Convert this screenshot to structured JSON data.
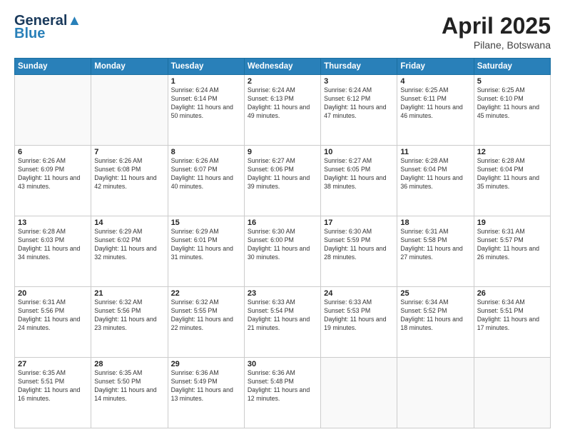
{
  "header": {
    "logo_line1": "General",
    "logo_line2": "Blue",
    "month_year": "April 2025",
    "location": "Pilane, Botswana"
  },
  "weekdays": [
    "Sunday",
    "Monday",
    "Tuesday",
    "Wednesday",
    "Thursday",
    "Friday",
    "Saturday"
  ],
  "weeks": [
    [
      {
        "day": null
      },
      {
        "day": null
      },
      {
        "day": "1",
        "sunrise": "6:24 AM",
        "sunset": "6:14 PM",
        "daylight": "11 hours and 50 minutes."
      },
      {
        "day": "2",
        "sunrise": "6:24 AM",
        "sunset": "6:13 PM",
        "daylight": "11 hours and 49 minutes."
      },
      {
        "day": "3",
        "sunrise": "6:24 AM",
        "sunset": "6:12 PM",
        "daylight": "11 hours and 47 minutes."
      },
      {
        "day": "4",
        "sunrise": "6:25 AM",
        "sunset": "6:11 PM",
        "daylight": "11 hours and 46 minutes."
      },
      {
        "day": "5",
        "sunrise": "6:25 AM",
        "sunset": "6:10 PM",
        "daylight": "11 hours and 45 minutes."
      }
    ],
    [
      {
        "day": "6",
        "sunrise": "6:26 AM",
        "sunset": "6:09 PM",
        "daylight": "11 hours and 43 minutes."
      },
      {
        "day": "7",
        "sunrise": "6:26 AM",
        "sunset": "6:08 PM",
        "daylight": "11 hours and 42 minutes."
      },
      {
        "day": "8",
        "sunrise": "6:26 AM",
        "sunset": "6:07 PM",
        "daylight": "11 hours and 40 minutes."
      },
      {
        "day": "9",
        "sunrise": "6:27 AM",
        "sunset": "6:06 PM",
        "daylight": "11 hours and 39 minutes."
      },
      {
        "day": "10",
        "sunrise": "6:27 AM",
        "sunset": "6:05 PM",
        "daylight": "11 hours and 38 minutes."
      },
      {
        "day": "11",
        "sunrise": "6:28 AM",
        "sunset": "6:04 PM",
        "daylight": "11 hours and 36 minutes."
      },
      {
        "day": "12",
        "sunrise": "6:28 AM",
        "sunset": "6:04 PM",
        "daylight": "11 hours and 35 minutes."
      }
    ],
    [
      {
        "day": "13",
        "sunrise": "6:28 AM",
        "sunset": "6:03 PM",
        "daylight": "11 hours and 34 minutes."
      },
      {
        "day": "14",
        "sunrise": "6:29 AM",
        "sunset": "6:02 PM",
        "daylight": "11 hours and 32 minutes."
      },
      {
        "day": "15",
        "sunrise": "6:29 AM",
        "sunset": "6:01 PM",
        "daylight": "11 hours and 31 minutes."
      },
      {
        "day": "16",
        "sunrise": "6:30 AM",
        "sunset": "6:00 PM",
        "daylight": "11 hours and 30 minutes."
      },
      {
        "day": "17",
        "sunrise": "6:30 AM",
        "sunset": "5:59 PM",
        "daylight": "11 hours and 28 minutes."
      },
      {
        "day": "18",
        "sunrise": "6:31 AM",
        "sunset": "5:58 PM",
        "daylight": "11 hours and 27 minutes."
      },
      {
        "day": "19",
        "sunrise": "6:31 AM",
        "sunset": "5:57 PM",
        "daylight": "11 hours and 26 minutes."
      }
    ],
    [
      {
        "day": "20",
        "sunrise": "6:31 AM",
        "sunset": "5:56 PM",
        "daylight": "11 hours and 24 minutes."
      },
      {
        "day": "21",
        "sunrise": "6:32 AM",
        "sunset": "5:56 PM",
        "daylight": "11 hours and 23 minutes."
      },
      {
        "day": "22",
        "sunrise": "6:32 AM",
        "sunset": "5:55 PM",
        "daylight": "11 hours and 22 minutes."
      },
      {
        "day": "23",
        "sunrise": "6:33 AM",
        "sunset": "5:54 PM",
        "daylight": "11 hours and 21 minutes."
      },
      {
        "day": "24",
        "sunrise": "6:33 AM",
        "sunset": "5:53 PM",
        "daylight": "11 hours and 19 minutes."
      },
      {
        "day": "25",
        "sunrise": "6:34 AM",
        "sunset": "5:52 PM",
        "daylight": "11 hours and 18 minutes."
      },
      {
        "day": "26",
        "sunrise": "6:34 AM",
        "sunset": "5:51 PM",
        "daylight": "11 hours and 17 minutes."
      }
    ],
    [
      {
        "day": "27",
        "sunrise": "6:35 AM",
        "sunset": "5:51 PM",
        "daylight": "11 hours and 16 minutes."
      },
      {
        "day": "28",
        "sunrise": "6:35 AM",
        "sunset": "5:50 PM",
        "daylight": "11 hours and 14 minutes."
      },
      {
        "day": "29",
        "sunrise": "6:36 AM",
        "sunset": "5:49 PM",
        "daylight": "11 hours and 13 minutes."
      },
      {
        "day": "30",
        "sunrise": "6:36 AM",
        "sunset": "5:48 PM",
        "daylight": "11 hours and 12 minutes."
      },
      {
        "day": null
      },
      {
        "day": null
      },
      {
        "day": null
      }
    ]
  ]
}
